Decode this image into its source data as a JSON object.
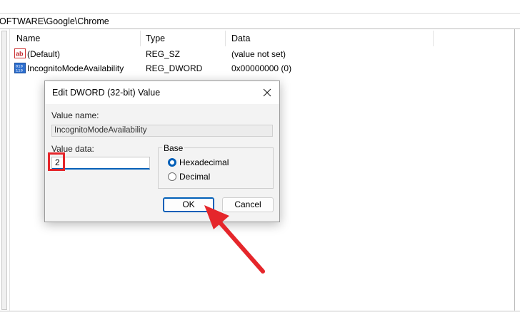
{
  "address": {
    "path": "OFTWARE\\Google\\Chrome"
  },
  "list": {
    "columns": [
      "Name",
      "Type",
      "Data"
    ],
    "rows": [
      {
        "icon": "string-value-icon",
        "name": "(Default)",
        "type": "REG_SZ",
        "data": "(value not set)"
      },
      {
        "icon": "dword-value-icon",
        "name": "IncognitoModeAvailability",
        "type": "REG_DWORD",
        "data": "0x00000000 (0)"
      }
    ]
  },
  "dialog": {
    "title": "Edit DWORD (32-bit) Value",
    "value_name_label": "Value name:",
    "value_name": "IncognitoModeAvailability",
    "value_data_label": "Value data:",
    "value_data": "2",
    "base_label": "Base",
    "base_options": [
      {
        "label": "Hexadecimal",
        "selected": true
      },
      {
        "label": "Decimal",
        "selected": false
      }
    ],
    "ok_label": "OK",
    "cancel_label": "Cancel"
  },
  "annotation": {
    "highlight_color": "#e5262b",
    "arrow_color": "#e5262b"
  }
}
